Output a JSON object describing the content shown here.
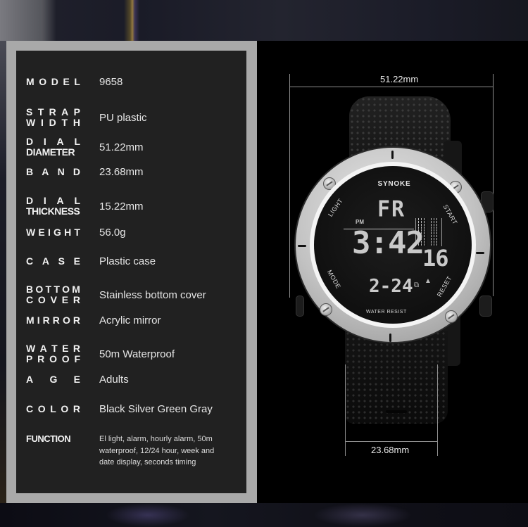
{
  "specs": [
    {
      "label_lines": [
        "MODEL"
      ],
      "value": "9658"
    },
    {
      "label_lines": [
        "STRAP",
        "WIDTH"
      ],
      "value": "PU plastic"
    },
    {
      "label_lines": [
        "DIAL",
        "DIAMETER"
      ],
      "value": "51.22mm"
    },
    {
      "label_lines": [
        "BAND"
      ],
      "value": "23.68mm"
    },
    {
      "label_lines": [
        "DIAL",
        "THICKNESS"
      ],
      "value": "15.22mm"
    },
    {
      "label_lines": [
        "WEIGHT"
      ],
      "value": "56.0g"
    },
    {
      "label_lines": [
        "CASE"
      ],
      "value": "Plastic case"
    },
    {
      "label_lines": [
        "BOTTOM",
        "COVER"
      ],
      "value": "Stainless bottom cover"
    },
    {
      "label_lines": [
        "MIRROR"
      ],
      "value": "Acrylic mirror"
    },
    {
      "label_lines": [
        "WATER",
        "PROOF"
      ],
      "value": "50m Waterproof"
    },
    {
      "label_lines": [
        "AGE"
      ],
      "value": "Adults"
    },
    {
      "label_lines": [
        "COLOR"
      ],
      "value": "Black Silver Green Gray"
    },
    {
      "label_lines": [
        "FUNCTION"
      ],
      "value": "El light, alarm, hourly alarm, 50m waterproof, 12/24 hour, week and date display, seconds timing"
    }
  ],
  "dimensions": {
    "dial_width": "51.22mm",
    "band_width": "23.68mm"
  },
  "watch": {
    "brand": "SYNOKE",
    "buttons": {
      "top_left": "LIGHT",
      "top_right": "START",
      "bottom_left": "MODE",
      "bottom_right": "RESET"
    },
    "footer": "WATER RESIST",
    "display": {
      "day": "FR",
      "meridiem": "PM",
      "time": "3:42",
      "seconds": "16",
      "date": "2-24"
    },
    "icons": [
      "signal-icon",
      "alarm-bell-icon"
    ]
  },
  "colors": {
    "panel_border": "#a9a9a9",
    "panel_fill": "#212121",
    "background": "#000000",
    "label_text": "#f2f2f2"
  }
}
